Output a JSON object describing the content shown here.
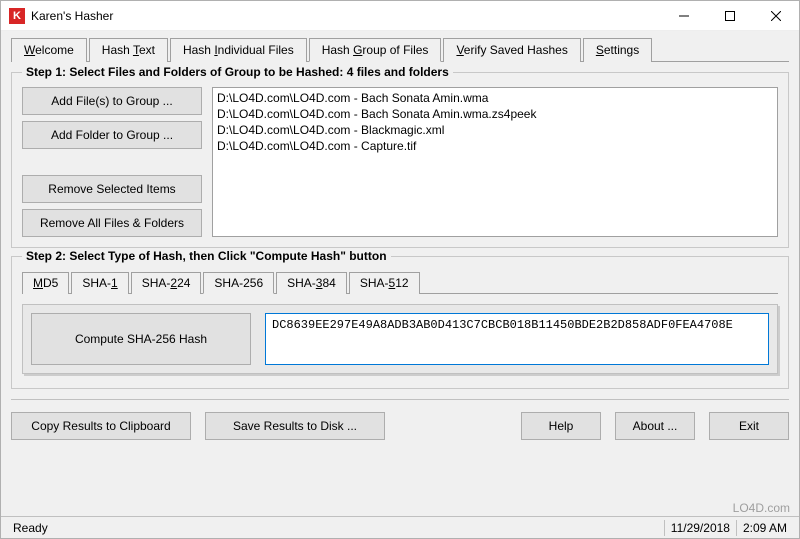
{
  "window": {
    "icon_letter": "K",
    "title": "Karen's Hasher"
  },
  "tabs": [
    {
      "pre": "",
      "ul": "W",
      "post": "elcome"
    },
    {
      "pre": "Hash ",
      "ul": "T",
      "post": "ext"
    },
    {
      "pre": "Hash ",
      "ul": "I",
      "post": "ndividual Files"
    },
    {
      "pre": "Hash ",
      "ul": "G",
      "post": "roup of Files"
    },
    {
      "pre": "",
      "ul": "V",
      "post": "erify Saved Hashes"
    },
    {
      "pre": "",
      "ul": "S",
      "post": "ettings"
    }
  ],
  "active_tab_index": 3,
  "step1": {
    "legend": "Step 1: Select Files and Folders of Group to be Hashed: 4 files and folders",
    "btn_add_files": "Add File(s) to Group ...",
    "btn_add_folder": "Add Folder to Group ...",
    "btn_remove_sel": "Remove Selected Items",
    "btn_remove_all": "Remove All Files & Folders",
    "files": [
      "D:\\LO4D.com\\LO4D.com - Bach Sonata Amin.wma",
      "D:\\LO4D.com\\LO4D.com - Bach Sonata Amin.wma.zs4peek",
      "D:\\LO4D.com\\LO4D.com - Blackmagic.xml",
      "D:\\LO4D.com\\LO4D.com - Capture.tif"
    ]
  },
  "step2": {
    "legend": "Step 2: Select Type of Hash, then Click \"Compute Hash\" button",
    "hash_tabs": [
      {
        "pre": "",
        "ul": "M",
        "post": "D5"
      },
      {
        "pre": "SHA-",
        "ul": "1",
        "post": ""
      },
      {
        "pre": "SHA-",
        "ul": "2",
        "post": "24"
      },
      {
        "pre": "SHA-256",
        "ul": "",
        "post": ""
      },
      {
        "pre": "SHA-",
        "ul": "3",
        "post": "84"
      },
      {
        "pre": "SHA-",
        "ul": "5",
        "post": "12"
      }
    ],
    "active_hash_tab_index": 3,
    "compute_btn": "Compute SHA-256 Hash",
    "hash_value": "DC8639EE297E49A8ADB3AB0D413C7CBCB018B11450BDE2B2D858ADF0FEA4708E"
  },
  "bottom": {
    "copy": "Copy Results to Clipboard",
    "save": "Save Results to Disk ...",
    "help": "Help",
    "about": "About ...",
    "exit": "Exit"
  },
  "status": {
    "ready": "Ready",
    "date": "11/29/2018",
    "time": "2:09 AM"
  },
  "watermark": "LO4D.com"
}
